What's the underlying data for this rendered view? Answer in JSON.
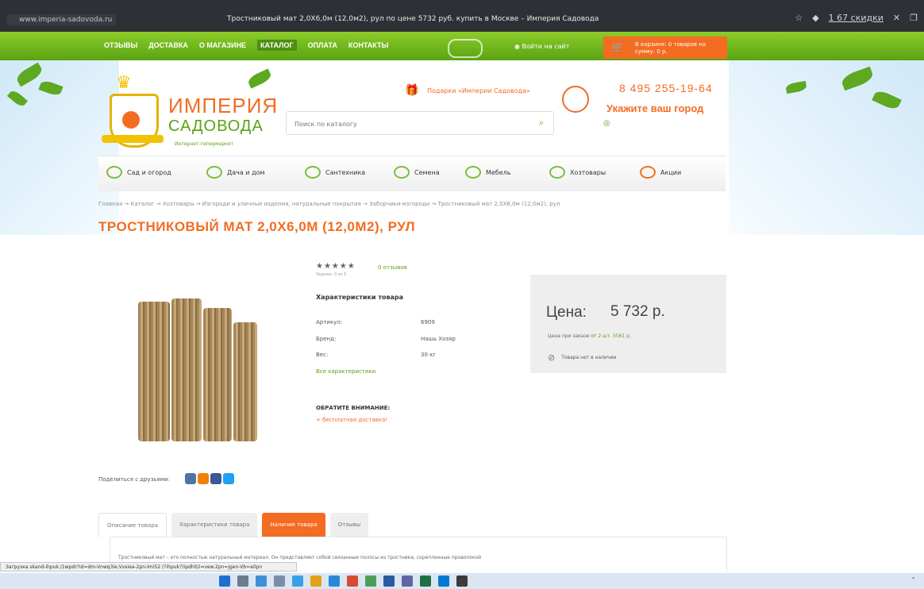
{
  "browser": {
    "url": "www.imperia-sadovoda.ru",
    "tab_title": "Тростниковый мат 2,0Х6,0м (12,0м2), рул по цене 5732 руб. купить в Москве – Империя Садовода",
    "right_link": "1 67 скидки"
  },
  "topnav": {
    "items": [
      "ОТЗЫВЫ",
      "ДОСТАВКА",
      "О МАГАЗИНЕ",
      "КАТАЛОГ",
      "ОПЛАТА",
      "КОНТАКТЫ"
    ],
    "login": "Войти на сайт",
    "cart": "В корзине: 0 товаров на сумму: 0 р."
  },
  "header": {
    "logo_line1": "ИМПЕРИЯ",
    "logo_line2": "САДОВОДА",
    "logo_sub": "Интернет-гипермаркет",
    "search_placeholder": "Поиск по каталогу",
    "gifts": "Подарки «Империи Садовода»",
    "phone": "8 495 255-19-64",
    "city": "Укажите ваш город"
  },
  "categories": [
    "Сад и огород",
    "Дача и дом",
    "Сантехника",
    "Семена",
    "Мебель",
    "Хозтовары",
    "Акции"
  ],
  "breadcrumb": "Главная → Каталог → Хозтовары → Изгороди и уличные изделия, натуральные покрытия → Заборчики-изгороди → Тростниковый мат 2,0Х6,0м (12,0м2), рул",
  "product": {
    "title": "ТРОСТНИКОВЫЙ МАТ 2,0Х6,0М (12,0М2), РУЛ",
    "rating": "★★★★★",
    "rating_note": "Оценок: 0 из 5",
    "reviews_link": "0 отзывов",
    "characteristics_title": "Характеристики товара",
    "characteristics": [
      {
        "name": "Артикул:",
        "value": "6909"
      },
      {
        "name": "Бренд:",
        "value": "Нашь Хозяр"
      },
      {
        "name": "Вес:",
        "value": "30 кг"
      }
    ],
    "all_characteristics": "Все характеристики",
    "attention": "ОБРАТИТЕ ВНИМАНИЕ:",
    "delivery": "+ бесплатная доставка!",
    "price_label": "Цена:",
    "price_value": "5 732 р.",
    "price_note_prefix": "Цена при заказе от ",
    "price_note_qty": "2 шт.",
    "price_note_value": "5561 р.",
    "stock": "Товара нет в наличии"
  },
  "share_label": "Поделиться с друзьями:",
  "tabs": [
    "Описание товара",
    "Характеристики товара",
    "Наличие товара",
    "Отзывы"
  ],
  "tab_text": "Тростниковый мат – это полностью натуральный материал. Он представляет собой связанные полосы из тростника, скрепленные проволокой",
  "status_bar": "Загрузка skand-ihpuk:/1wpdr?id=dm-Vnwq3ie,Vvsiea-2pn-lmi52  (?ihpuk?)ipdhit/i=vew.2pn=jgen-Vb=a0pn",
  "colors": {
    "green": "#5aa313",
    "orange": "#f36c21",
    "gold": "#f2c200"
  }
}
